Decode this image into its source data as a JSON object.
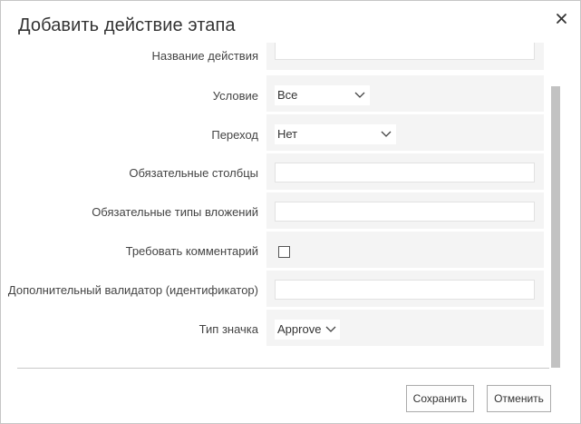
{
  "dialog": {
    "title": "Добавить действие этапа",
    "close_icon": "close-icon"
  },
  "form": {
    "action_name": {
      "label": "Название действия",
      "value": ""
    },
    "condition": {
      "label": "Условие",
      "value": "Все"
    },
    "transition": {
      "label": "Переход",
      "value": "Нет"
    },
    "required_columns": {
      "label": "Обязательные столбцы",
      "value": ""
    },
    "required_attachment_types": {
      "label": "Обязательные типы вложений",
      "value": ""
    },
    "require_comment": {
      "label": "Требовать комментарий",
      "checked": false
    },
    "extra_validator": {
      "label": "Дополнительный валидатор (идентификатор)",
      "value": ""
    },
    "icon_type": {
      "label": "Тип значка",
      "value": "Approve"
    }
  },
  "footer": {
    "save_label": "Сохранить",
    "cancel_label": "Отменить"
  },
  "colors": {
    "cell_background": "#f4f4f4",
    "scroll_thumb": "#c2c2c2",
    "divider": "#c8c8c8"
  }
}
